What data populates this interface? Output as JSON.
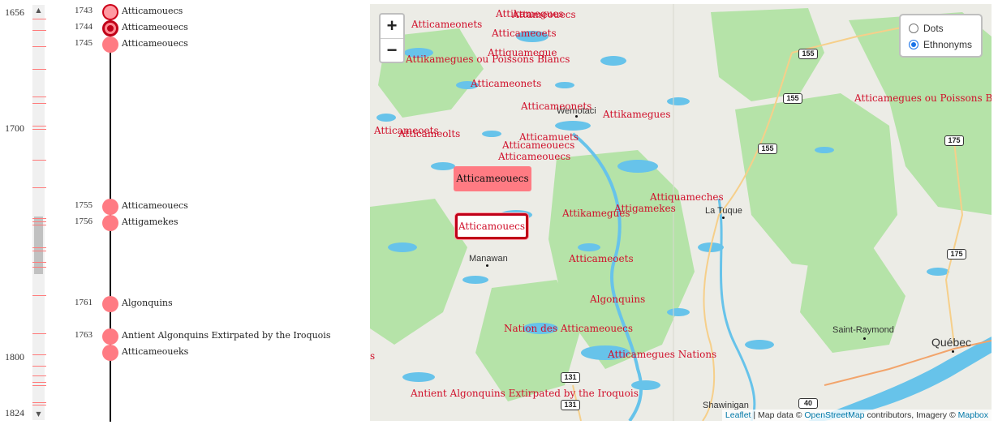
{
  "axis": {
    "year_labels": [
      "1656",
      "1700",
      "1800",
      "1824"
    ]
  },
  "timeline": {
    "events": [
      {
        "year": "1743",
        "name": "Atticamouecs"
      },
      {
        "year": "1744",
        "name": "Atticameouecs"
      },
      {
        "year": "1745",
        "name": "Atticameouecs"
      },
      {
        "year": "1755",
        "name": "Atticameouecs"
      },
      {
        "year": "1756",
        "name": "Attigamekes"
      },
      {
        "year": "1761",
        "name": "Algonquins"
      },
      {
        "year": "1763",
        "name": "Antient Algonquins Extirpated by the Iroquois"
      },
      {
        "year": "",
        "name": "Atticameoueks"
      }
    ]
  },
  "map": {
    "zoom_in": "+",
    "zoom_out": "−",
    "layers": {
      "dots": "Dots",
      "ethnonyms": "Ethnonyms",
      "selected": "Ethnonyms"
    },
    "labels": [
      "Attikamegues",
      "Attameouecs",
      "Atticameonets",
      "Atticameoets",
      "Attiquameque",
      "Attikamegues ou Poissons Blancs",
      "Atticameonets",
      "Atticameonets",
      "Attikamegues",
      "Atticameoets",
      "Atticameolts",
      "Atticamuets",
      "Atticameouecs",
      "Atticameouecs",
      "Attiquameches",
      "Attikamegues",
      "Attigamekes",
      "Atticameoets",
      "Algonquins",
      "Nation des Atticameouecs",
      "Atticamegues Nations",
      "Antient Algonquins Extirpated by the Iroquois",
      "Atticamegues ou Poissons Blancs",
      "s"
    ],
    "popup_highlight": "Atticameouecs",
    "popup_selected": "Atticamouecs",
    "towns": [
      "Wemotaci",
      "La Tuque",
      "Manawan",
      "Saint-Raymond",
      "Québec",
      "Shawinigan"
    ],
    "highways": [
      "155",
      "155",
      "155",
      "175",
      "175",
      "131",
      "131",
      "40"
    ],
    "attribution": {
      "leaflet": "Leaflet",
      "text1": "| Map data ©",
      "osm": "OpenStreetMap",
      "text2": "contributors, Imagery ©",
      "mapbox": "Mapbox"
    },
    "colors": {
      "water": "#67c3ea",
      "forest": "#b5e3a8",
      "land": "#ecece6",
      "label": "#d0102b",
      "dot": "#ff7b83",
      "selected": "#c00018"
    }
  }
}
